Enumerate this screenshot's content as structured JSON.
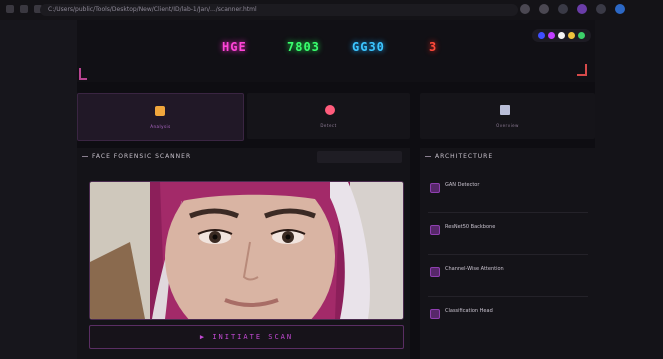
{
  "browser": {
    "url": "C:/Users/public/Tools/Desktop/New/Client/ID/lab-1/Jan/.../scanner.html"
  },
  "header": {
    "stats": [
      "HGE",
      "7803",
      "GG30",
      "3"
    ],
    "theme_toggle_colors": [
      "#3f4fff",
      "#c03cff",
      "#f4f4f4",
      "#f0c23c",
      "#3cd06a"
    ]
  },
  "tabs": [
    {
      "label": "Analysis",
      "icon": "box-icon"
    },
    {
      "label": "Detect",
      "icon": "target-icon"
    },
    {
      "label": "Overview",
      "icon": "chart-icon"
    }
  ],
  "scanner": {
    "title": "FACE FORENSIC SCANNER",
    "header_button": "",
    "initiate_label": "▶ INITIATE SCAN"
  },
  "architecture": {
    "title": "ARCHITECTURE",
    "items": [
      {
        "name": "GAN Detector",
        "desc": ""
      },
      {
        "name": "ResNet50 Backbone",
        "desc": ""
      },
      {
        "name": "Channel-Wise Attention",
        "desc": ""
      },
      {
        "name": "Classification Head",
        "desc": ""
      }
    ]
  },
  "colors": {
    "accent": "#c34ad4",
    "stat_magenta": "#ff45d8",
    "stat_green": "#39ff6e",
    "stat_cyan": "#3cc6ff",
    "stat_red": "#ff4a3a"
  }
}
